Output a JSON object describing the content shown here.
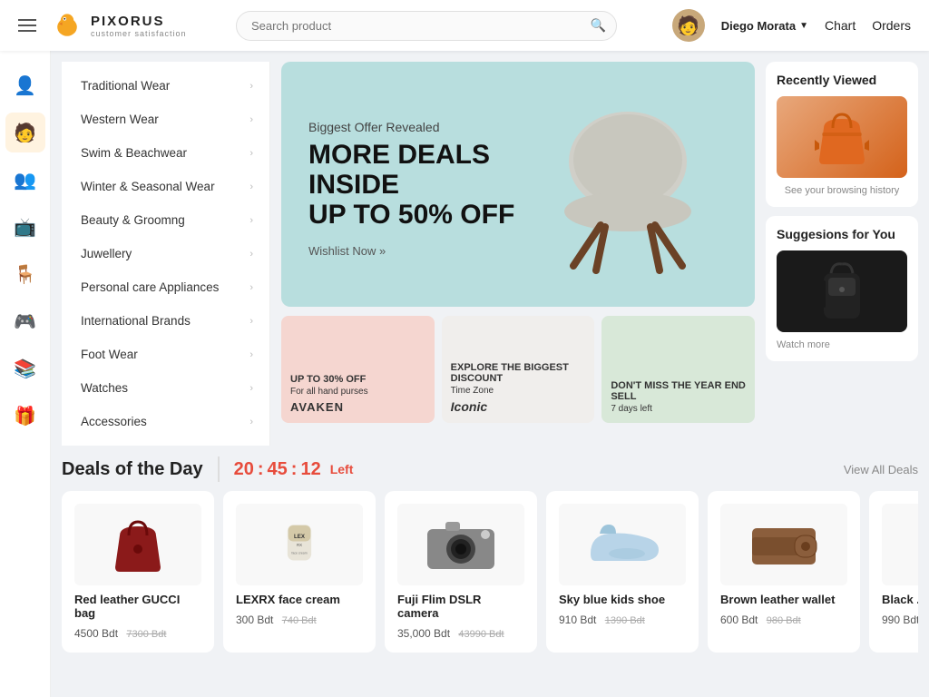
{
  "header": {
    "hamburger_label": "menu",
    "logo_name": "PIXORUS",
    "logo_tagline": "customer satisfaction",
    "search_placeholder": "Search product",
    "user_name": "Diego Morata",
    "nav_chart": "Chart",
    "nav_orders": "Orders"
  },
  "sidebar_icons": [
    {
      "name": "user-icon",
      "glyph": "👤",
      "active": false
    },
    {
      "name": "person-icon",
      "glyph": "🧑",
      "active": true
    },
    {
      "name": "customer-icon",
      "glyph": "👥",
      "active": false
    },
    {
      "name": "tv-icon",
      "glyph": "📺",
      "active": false
    },
    {
      "name": "chair-icon",
      "glyph": "🪑",
      "active": false
    },
    {
      "name": "game-icon",
      "glyph": "🎮",
      "active": false
    },
    {
      "name": "shelf-icon",
      "glyph": "📚",
      "active": false
    },
    {
      "name": "gift-icon",
      "glyph": "🎁",
      "active": false
    }
  ],
  "categories": [
    {
      "label": "Traditional Wear"
    },
    {
      "label": "Western Wear"
    },
    {
      "label": "Swim & Beachwear"
    },
    {
      "label": "Winter & Seasonal Wear"
    },
    {
      "label": "Beauty & Groomng"
    },
    {
      "label": "Juwellery"
    },
    {
      "label": "Personal care Appliances"
    },
    {
      "label": "International Brands"
    },
    {
      "label": "Foot Wear"
    },
    {
      "label": "Watches"
    },
    {
      "label": "Accessories"
    }
  ],
  "hero": {
    "sub": "Biggest Offer Revealed",
    "title": "MORE DEALS INSIDE\nUP TO 50% OFF",
    "cta": "Wishlist Now »"
  },
  "mini_banners": [
    {
      "title": "UP TO 30% OFF",
      "subtitle": "For all hand purses",
      "brand": "AVAKEN",
      "bg": "pink"
    },
    {
      "title": "EXPLORE THE BIGGEST DISCOUNT",
      "subtitle": "Time Zone",
      "brand": "Iconic",
      "bg": "white"
    },
    {
      "title": "DON'T MISS THE YEAR END SELL",
      "subtitle": "7 days left",
      "brand": "",
      "bg": "green"
    }
  ],
  "right_panel": {
    "recently_title": "Recently Viewed",
    "see_history": "See your browsing history",
    "suggestions_title": "Suggesions for You",
    "watch_more": "Watch more"
  },
  "deals": {
    "title": "Deals of the Day",
    "timer_h": "20",
    "timer_m": "45",
    "timer_s": "12",
    "timer_label": "Left",
    "view_all": "View All Deals",
    "items": [
      {
        "name": "Red leather GUCCI bag",
        "price": "4500 Bdt",
        "original": "7300 Bdt",
        "bg": "#8b1a1a"
      },
      {
        "name": "LEXRX face cream",
        "price": "300 Bdt",
        "original": "740 Bdt",
        "bg": "#e8e4d8"
      },
      {
        "name": "Fuji Flim DSLR camera",
        "price": "35,000 Bdt",
        "original": "43990 Bdt",
        "bg": "#d0d0d0"
      },
      {
        "name": "Sky blue kids shoe",
        "price": "910 Bdt",
        "original": "1390 Bdt",
        "bg": "#b8d4e8"
      },
      {
        "name": "Brown leather wallet",
        "price": "600 Bdt",
        "original": "980 Bdt",
        "bg": "#8b5e3c"
      },
      {
        "name": "Black ...",
        "price": "990 Bdt",
        "original": "",
        "bg": "#222"
      }
    ]
  }
}
